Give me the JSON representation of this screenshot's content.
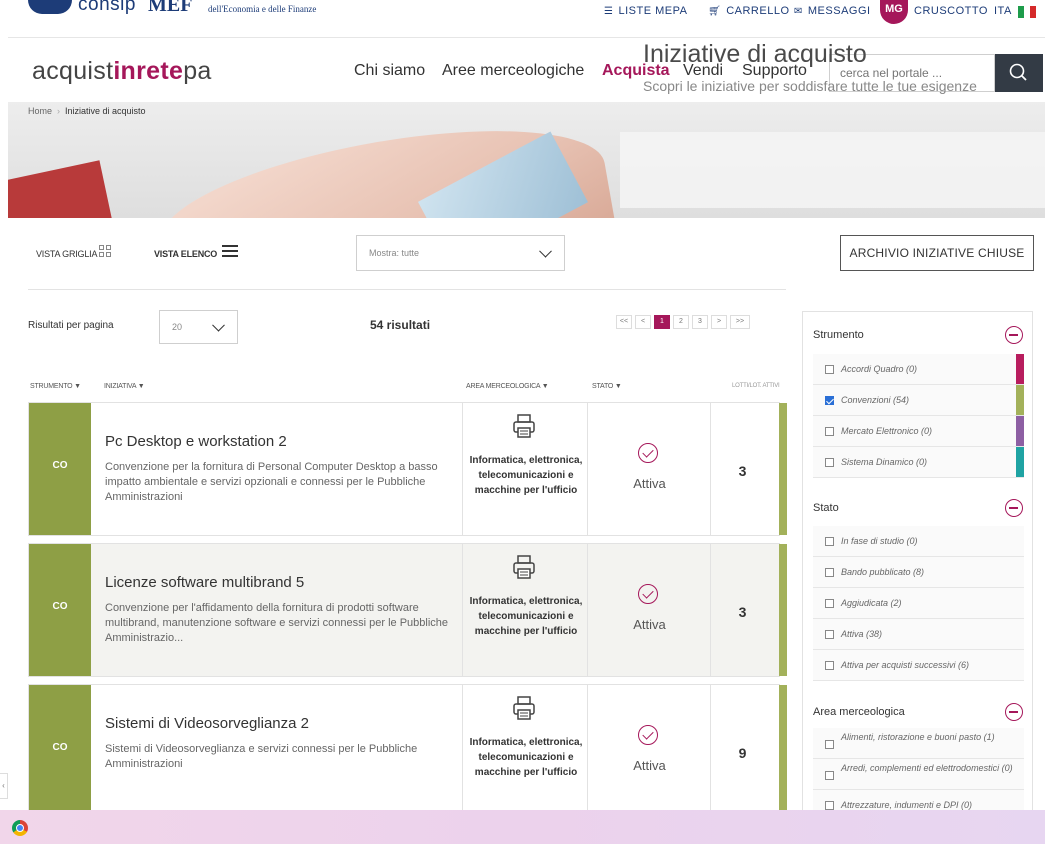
{
  "topbar": {
    "consip": "consip",
    "mef": "MEF",
    "mef_sub": "dell'Economia e delle Finanze",
    "nav": [
      "LISTE MEPA",
      "CARRELLO",
      "MESSAGGI",
      "CRUSCOTTO",
      "ITA"
    ],
    "avatar_initials": "MG"
  },
  "header": {
    "brand_prefix": "acquist",
    "brand_bold": "inrete",
    "brand_suffix": "pa",
    "nav": [
      "Chi siamo",
      "Aree merceologiche",
      "Acquista",
      "Vendi",
      "Supporto"
    ],
    "active_nav": "Acquista",
    "search_placeholder": "cerca nel portale ..."
  },
  "breadcrumb": [
    "Home",
    "Iniziative di acquisto"
  ],
  "hero": {
    "title": "Iniziative di acquisto",
    "subtitle": "Scopri le iniziative per soddisfare tutte le tue esigenze"
  },
  "view": {
    "grid_label": "VISTA GRIGLIA",
    "list_label": "VISTA ELENCO",
    "filter_value": "Mostra: tutte",
    "archive_button": "ARCHIVIO INIZIATIVE CHIUSE"
  },
  "results": {
    "per_page_label": "Risultati per pagina",
    "per_page_value": "20",
    "count_label": "54 risultati",
    "pager": [
      "<<",
      "<",
      "1",
      "2",
      "3",
      ">",
      ">>"
    ],
    "current_page": "1"
  },
  "columns": {
    "strumento": "STRUMENTO ▼",
    "iniziativa": "INIZIATIVA ▼",
    "area": "AREA MERCEOLOGICA ▼",
    "stato": "STATO ▼",
    "lotti": "LOTTI/LOT. ATTIVI"
  },
  "rows": [
    {
      "tag": "CO",
      "title": "Pc Desktop e workstation 2",
      "desc": "Convenzione per la fornitura di Personal Computer Desktop a basso impatto ambientale e servizi opzionali e connessi per le Pubbliche Amministrazioni",
      "area": "Informatica, elettronica, telecomunicazioni e macchine per l'ufficio",
      "stato": "Attiva",
      "lotti": "3"
    },
    {
      "tag": "CO",
      "title": "Licenze software multibrand 5",
      "desc": "Convenzione per l'affidamento della fornitura di prodotti software multibrand, manutenzione software e servizi connessi per le Pubbliche Amministrazio...",
      "area": "Informatica, elettronica, telecomunicazioni e macchine per l'ufficio",
      "stato": "Attiva",
      "lotti": "3"
    },
    {
      "tag": "CO",
      "title": "Sistemi di Videosorveglianza 2",
      "desc": "Sistemi di Videosorveglianza e servizi connessi per le Pubbliche Amministrazioni",
      "area": "Informatica, elettronica, telecomunicazioni e macchine per l'ufficio",
      "stato": "Attiva",
      "lotti": "9"
    }
  ],
  "filters": {
    "strumento": {
      "title": "Strumento",
      "items": [
        {
          "label": "Accordi Quadro (0)",
          "checked": false,
          "color": "#b81d5e"
        },
        {
          "label": "Convenzioni (54)",
          "checked": true,
          "color": "#a3b15a"
        },
        {
          "label": "Mercato Elettronico (0)",
          "checked": false,
          "color": "#8d5fa3"
        },
        {
          "label": "Sistema Dinamico (0)",
          "checked": false,
          "color": "#1fa3a3"
        }
      ]
    },
    "stato": {
      "title": "Stato",
      "items": [
        {
          "label": "In fase di studio (0)"
        },
        {
          "label": "Bando pubblicato (8)"
        },
        {
          "label": "Aggiudicata (2)"
        },
        {
          "label": "Attiva (38)"
        },
        {
          "label": "Attiva per acquisti successivi (6)"
        }
      ]
    },
    "area": {
      "title": "Area merceologica",
      "items": [
        {
          "label": "Alimenti, ristorazione e buoni pasto (1)"
        },
        {
          "label": "Arredi, complementi ed elettrodomestici (0)"
        },
        {
          "label": "Attrezzature, indumenti e DPI (0)"
        }
      ]
    }
  },
  "colors": {
    "brand": "#a5175a",
    "tag_green": "#8e9f45",
    "accent_green": "#a3b15a",
    "navy": "#1d3c78"
  }
}
